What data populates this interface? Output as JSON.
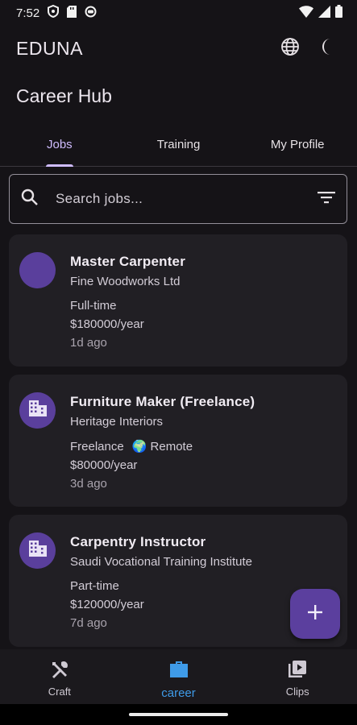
{
  "status_bar": {
    "time": "7:52"
  },
  "app_bar": {
    "title": "EDUNA"
  },
  "page_title": "Career Hub",
  "tabs": [
    {
      "label": "Jobs",
      "active": true
    },
    {
      "label": "Training",
      "active": false
    },
    {
      "label": "My Profile",
      "active": false
    }
  ],
  "search": {
    "placeholder": "Search jobs..."
  },
  "jobs": [
    {
      "title": "Master Carpenter",
      "company": "Fine Woodworks Ltd",
      "type": "Full-time",
      "remote": "",
      "salary": "$180000/year",
      "posted": "1d ago",
      "icon": "none"
    },
    {
      "title": "Furniture Maker (Freelance)",
      "company": "Heritage Interiors",
      "type": "Freelance",
      "remote": "🌍 Remote",
      "salary": "$80000/year",
      "posted": "3d ago",
      "icon": "building-icon"
    },
    {
      "title": "Carpentry Instructor",
      "company": "Saudi Vocational Training Institute",
      "type": "Part-time",
      "remote": "",
      "salary": "$120000/year",
      "posted": "7d ago",
      "icon": "building-icon"
    }
  ],
  "fab": {
    "label": "+"
  },
  "bottom_nav": [
    {
      "label": "Craft",
      "icon": "tools-icon",
      "active": false
    },
    {
      "label": "career",
      "icon": "briefcase-icon",
      "active": true
    },
    {
      "label": "Clips",
      "icon": "video-library-icon",
      "active": false
    }
  ],
  "colors": {
    "background": "#151317",
    "card": "#211f24",
    "accent": "#cfbcff",
    "avatar": "#5a3f9c",
    "nav_active": "#3f9be8"
  }
}
